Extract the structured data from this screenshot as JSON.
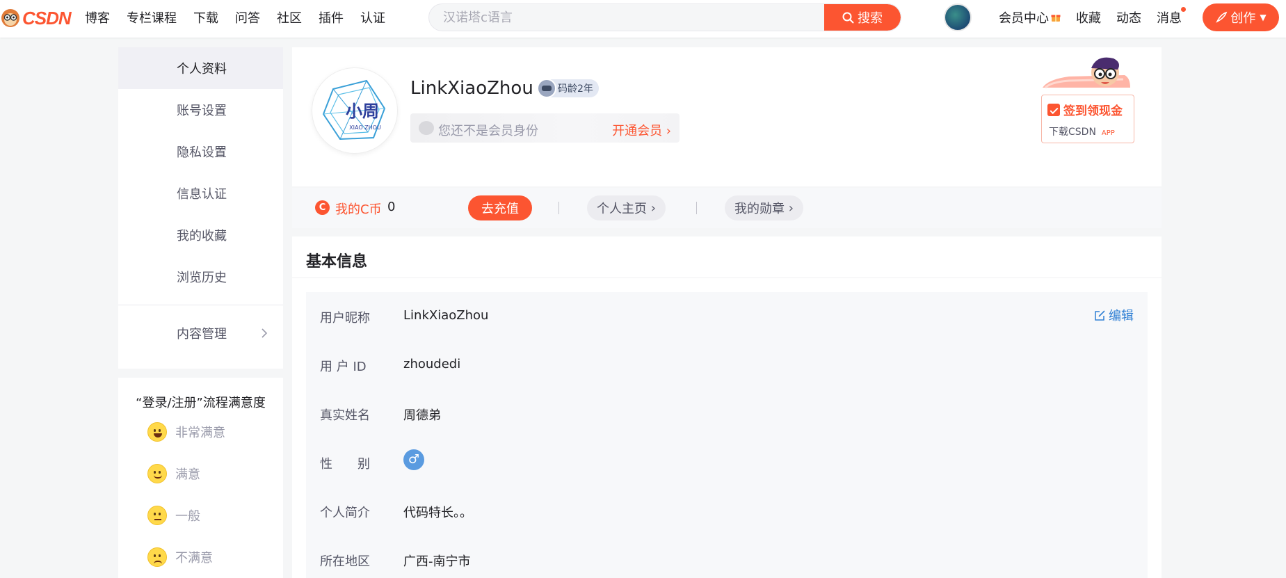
{
  "topbar": {
    "logo_text": "CSDN",
    "nav": [
      "博客",
      "专栏课程",
      "下载",
      "问答",
      "社区",
      "插件",
      "认证"
    ],
    "search_placeholder": "汉诺塔c语言",
    "search_button": "搜索",
    "links": {
      "vip_center": "会员中心",
      "favorites": "收藏",
      "activity": "动态",
      "messages": "消息"
    },
    "create_button": "创作",
    "accent_color": "#fc5531"
  },
  "sidebar": {
    "items": [
      "个人资料",
      "账号设置",
      "隐私设置",
      "信息认证",
      "我的收藏",
      "浏览历史"
    ],
    "content_management": "内容管理",
    "active_item": "个人资料"
  },
  "survey": {
    "title": "“登录/注册”流程满意度",
    "options": [
      "非常满意",
      "满意",
      "一般",
      "不满意"
    ]
  },
  "profile": {
    "avatar_text_main": "小周",
    "avatar_text_sub": "XIAO ZHOU",
    "username": "LinkXiaoZhou",
    "code_age": "码龄2年",
    "vip_status": "您还不是会员身份",
    "vip_open": "开通会员",
    "signin_title": "签到领现金",
    "signin_sub": "下载CSDN",
    "signin_app": "APP"
  },
  "stats": {
    "coin_icon": "C",
    "coin_label": "我的C币",
    "coin_value": "0",
    "recharge": "去充值",
    "homepage": "个人主页",
    "medals": "我的勋章"
  },
  "basic_info": {
    "title": "基本信息",
    "edit": "编辑",
    "rows": [
      {
        "label": "用户昵称",
        "value": "LinkXiaoZhou"
      },
      {
        "label": "用 户 ID",
        "value": "zhoudedi"
      },
      {
        "label": "真实姓名",
        "value": "周德弟"
      },
      {
        "label": "性　　别",
        "value": "♂"
      },
      {
        "label": "个人简介",
        "value": "代码特长。。"
      },
      {
        "label": "所在地区",
        "value": "广西-南宁市"
      }
    ]
  }
}
